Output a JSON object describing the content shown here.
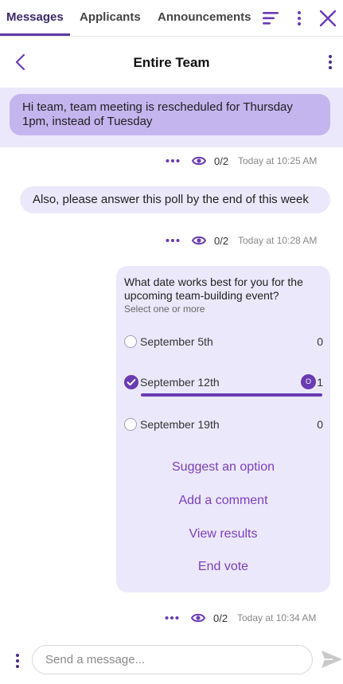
{
  "tabs": [
    {
      "label": "Messages",
      "active": true
    },
    {
      "label": "Applicants",
      "active": false
    },
    {
      "label": "Announcements",
      "active": false
    }
  ],
  "top_icons": [
    "filter-icon",
    "more-vertical-icon",
    "close-icon"
  ],
  "header": {
    "title": "Entire Team",
    "back_icon": "chevron-left-icon",
    "more_icon": "more-vertical-icon"
  },
  "messages": [
    {
      "text": "Hi team, team meeting is rescheduled for Thursday 1pm, instead of Tuesday",
      "seen": "0/2",
      "time": "Today at 10:25 AM"
    },
    {
      "text": "Also, please answer this poll by the end of this week",
      "seen": "0/2",
      "time": "Today at 10:28 AM"
    }
  ],
  "poll": {
    "question": "What date works best for you for the upcoming team-building event?",
    "hint": "Select one or more",
    "options": [
      {
        "label": "September 5th",
        "votes": "0",
        "selected": false
      },
      {
        "label": "September 12th",
        "votes": "1",
        "selected": true,
        "voter_initial": "O",
        "share": 1.0
      },
      {
        "label": "September 19th",
        "votes": "0",
        "selected": false
      }
    ],
    "actions": [
      "Suggest an option",
      "Add a comment",
      "View results",
      "End vote"
    ],
    "seen": "0/2",
    "time": "Today at 10:34 AM"
  },
  "composer": {
    "placeholder": "Send a message..."
  },
  "colors": {
    "accent": "#6a3bb3",
    "bubble_highlight": "#c4b5ee",
    "bubble_light": "#ece8fb",
    "action_text": "#7a3fbf"
  }
}
